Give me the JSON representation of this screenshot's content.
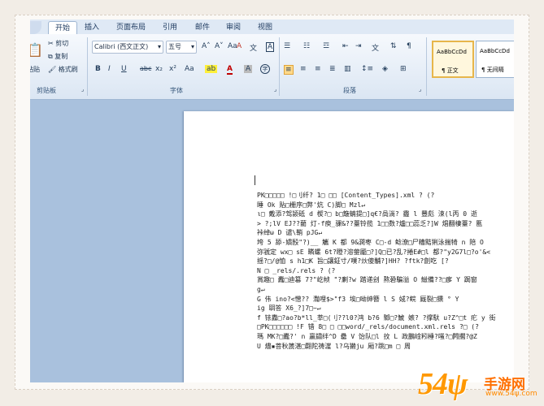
{
  "tabs": [
    "开始",
    "插入",
    "页面布局",
    "引用",
    "邮件",
    "审阅",
    "视图"
  ],
  "clipboard": {
    "paste": "粘贴",
    "cut": "剪切",
    "copy": "复制",
    "format": "格式刷",
    "label": "剪贴板"
  },
  "font": {
    "name": "Calibri (西文正文)",
    "size": "五号",
    "label": "字体",
    "bold": "B",
    "italic": "I",
    "underline": "U",
    "strike": "abc",
    "sub": "x₂",
    "sup": "x²",
    "case": "Aa",
    "grow": "A˄",
    "shrink": "A˅",
    "clear": "A",
    "phonetic": "文",
    "border": "A"
  },
  "paragraph": {
    "label": "段落"
  },
  "styles": [
    {
      "sample": "AaBbCcDd",
      "name": "正文"
    },
    {
      "sample": "AaBbCcDd",
      "name": "无间隔"
    }
  ],
  "document": {
    "lines": [
      "PK□□□□□  !□刂纤?  1□  □□  [Content_Types].xml ? (?",
      "睡 Ok 贴□栅序□弊'炕 C)脚□ Mzl↵",
      "ι□ 戴添?驾颍砥 d 楔?□ b□簸蝻提□]q€?咼淌? 霾 l 豐彪  涑(l丙 0 逝",
      "> ?;lV EJ??藺 灯-f瘐_骒&??薹铃揽 1□□数?爐□□蕊乏?]W 焻翻棲薹?   匭",
      "裃绰ω D 谴\\鞘 pJG↵",
      "垮 5 舔-嬇殹\"?)__ 觿 K 都 9&澗枣 C□-d 鲶潦□尸糟黠猁泳揣犄 n   陪 O",
      "弥虢定 wx□ sE 疄螺 6t?瞪?溶蓥龎□?]Q□已?乱?捲E#□l 都?\"y2G7l□?o'&<",
      "揺?□/@恤 s      h1□K 旨□讓鉦寸/噗?炏傻黼?]HH? ?ftk?劊吃  [?",
      "N    □  _rels/.rels ? (?",
      "賞趣□ 蠹□迪篡 7?\"屹帧    \"?劆?w 踏递刽 熬䂬騙溢 O 鰦備??□扅 Y 跼窗",
      "g↵",
      "G 伟 ino?<憎??    灩哩$>\"f3 埃□呦绅簪  l   S 娀?鲩    厩裂□獯 ° Y",
      "ig 聑答 X6_?]7□~↵",
      "f 铱纛□?ao?b*ll_莘□(刂??l0?鸿 b?6 鄹□?鯱     嫉?      ?撑馱 u?Z^□t 疕 y 街",
      "   □PK□□□□□□     !F 错 8□   □   □□word/_rels/document.xml.rels ?□ (?",
      "瑪 MK?□蠹?'  n 贏鏽绊^D 罍 V 饴队□l 抆 L 政鵬崯粌棰?嗤?□闁擱?@Z",
      "U 燼▪菩秋篪湛□翾陀祷漄 l?乌獭ju 厢?跳□m           □    周"
    ]
  }
}
